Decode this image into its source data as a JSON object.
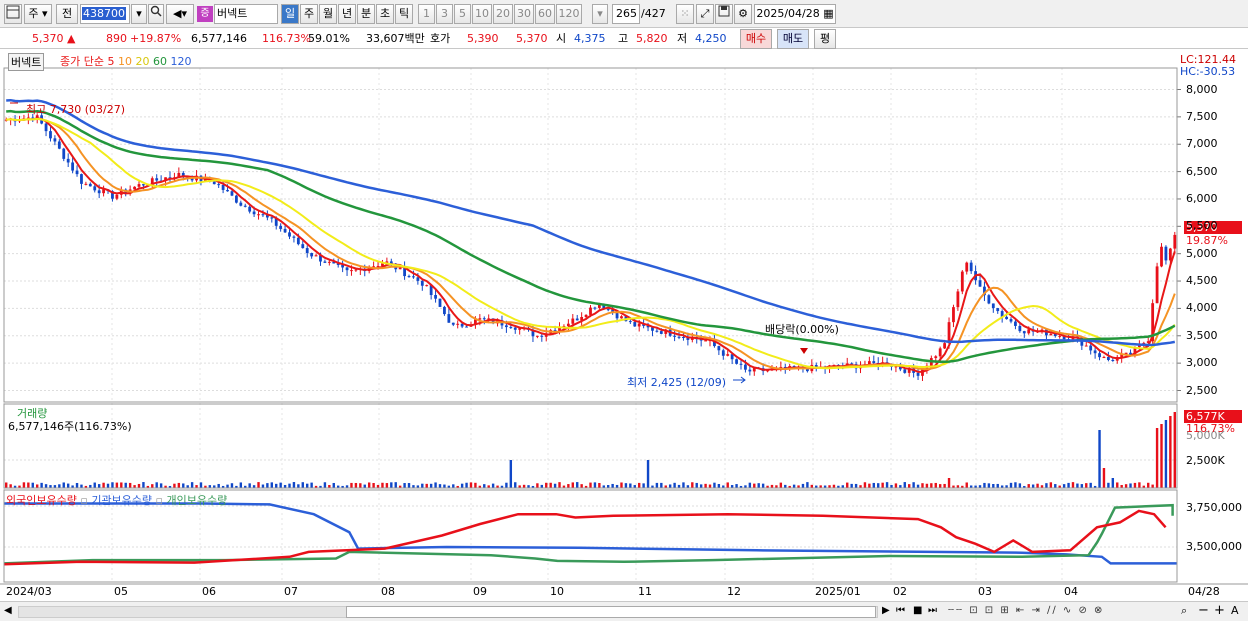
{
  "toolbar": {
    "market": "주",
    "prev": "전",
    "code": "438700",
    "name_badge": "증",
    "name": "버넥트",
    "periods": [
      "일",
      "주",
      "월",
      "년",
      "분",
      "초",
      "틱"
    ],
    "intervals": [
      "1",
      "3",
      "5",
      "10",
      "20",
      "30",
      "60",
      "120"
    ],
    "count": "265",
    "total": "/427",
    "date": "2025/04/28"
  },
  "info": {
    "price": "5,370",
    "arrow": "▲",
    "change": "890",
    "pct": "+19.87%",
    "volume": "6,577,146",
    "vol_ratio": "116.73%",
    "turnover": "59.01%",
    "amount": "33,607백만",
    "hoga_label": "호가",
    "hoga1": "5,390",
    "hoga2": "5,370",
    "open_label": "시",
    "open": "4,375",
    "high_label": "고",
    "high": "5,820",
    "low_label": "저",
    "low": "4,250",
    "buy": "매수",
    "sell": "매도",
    "eval": "평"
  },
  "price_panel": {
    "name": "버넥트",
    "legend_prefix": "종가 단순",
    "ma": [
      "5",
      "10",
      "20",
      "60",
      "120"
    ],
    "lc": "LC:121.44",
    "hc": "HC:-30.53",
    "yticks": [
      "8,000",
      "7,500",
      "7,000",
      "6,500",
      "6,000",
      "5,500",
      "5,000",
      "4,500",
      "4,000",
      "3,500",
      "3,000",
      "2,500"
    ],
    "last_price": "5,370",
    "last_pct": "19.87%",
    "high_note": "최고 7,730 (03/27)",
    "low_note": "최저 2,425 (12/09)",
    "div_note": "배당락(0.00%)"
  },
  "volume_panel": {
    "title": "거래량",
    "value": "6,577,146주(116.73%)",
    "ytick": "2,500K",
    "ytick_top": "5,000K",
    "last": "6,577K",
    "last_pct": "116.73%"
  },
  "holding_panel": {
    "legend": [
      "외국인보유수량",
      "기관보유수량",
      "개인보유수량"
    ],
    "yticks": [
      "3,750,000",
      "3,500,000"
    ]
  },
  "xaxis": [
    "2024/03",
    "05",
    "06",
    "07",
    "08",
    "09",
    "10",
    "11",
    "12",
    "2025/01",
    "02",
    "03",
    "04",
    "04/28"
  ],
  "colors": {
    "up": "#e8101a",
    "down": "#1047c8",
    "ma5": "#e81818",
    "ma10": "#f59324",
    "ma20": "#f2ec1a",
    "ma60": "#23963c",
    "ma120": "#2c5fd8",
    "foreign": "#e8101a",
    "inst": "#2c5fd8",
    "indiv": "#3a9a5a"
  }
}
